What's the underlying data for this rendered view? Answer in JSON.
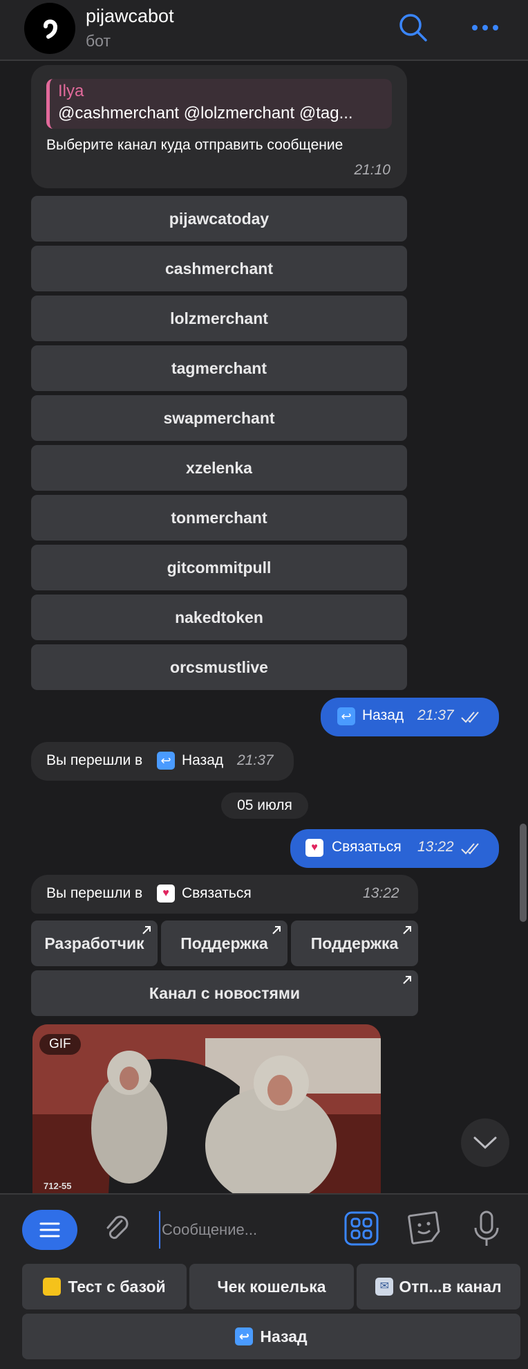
{
  "header": {
    "title": "pijawcabot",
    "subtitle": "бот"
  },
  "messages": {
    "quote": {
      "author": "Ilya",
      "text": "@cashmerchant @lolzmerchant @tag..."
    },
    "choose_channel": {
      "text": "Выберите канал куда отправить сообщение",
      "time": "21:10"
    },
    "channel_buttons": [
      "pijawcatoday",
      "cashmerchant",
      "lolzmerchant",
      "tagmerchant",
      "swapmerchant",
      "xzelenka",
      "tonmerchant",
      "gitcommitpull",
      "nakedtoken",
      "orcsmustlive"
    ],
    "out_back": {
      "text": "Назад",
      "time": "21:37"
    },
    "in_back": {
      "prefix": "Вы перешли в",
      "text": "Назад",
      "time": "21:37"
    },
    "date_separator": "05 июля",
    "out_contact": {
      "text": "Связаться",
      "time": "13:22"
    },
    "in_contact": {
      "prefix": "Вы перешли в",
      "text": "Связаться",
      "time": "13:22"
    },
    "contact_buttons": [
      "Разработчик",
      "Поддержка",
      "Поддержка"
    ],
    "news_button": "Канал с новостями",
    "gif": {
      "label": "GIF",
      "caption": "712-55"
    }
  },
  "composer": {
    "placeholder": "Сообщение..."
  },
  "reply_keyboard": {
    "row1": [
      "Тест с базой",
      "Чек кошелька",
      "Отп...в канал"
    ],
    "row2": "Назад"
  },
  "colors": {
    "accent": "#2f6fe8",
    "outgoing_bubble": "#2a64d6",
    "incoming_bubble": "#2c2c2e",
    "quote_name": "#e26a9b",
    "button_bg": "#3a3b3f"
  }
}
